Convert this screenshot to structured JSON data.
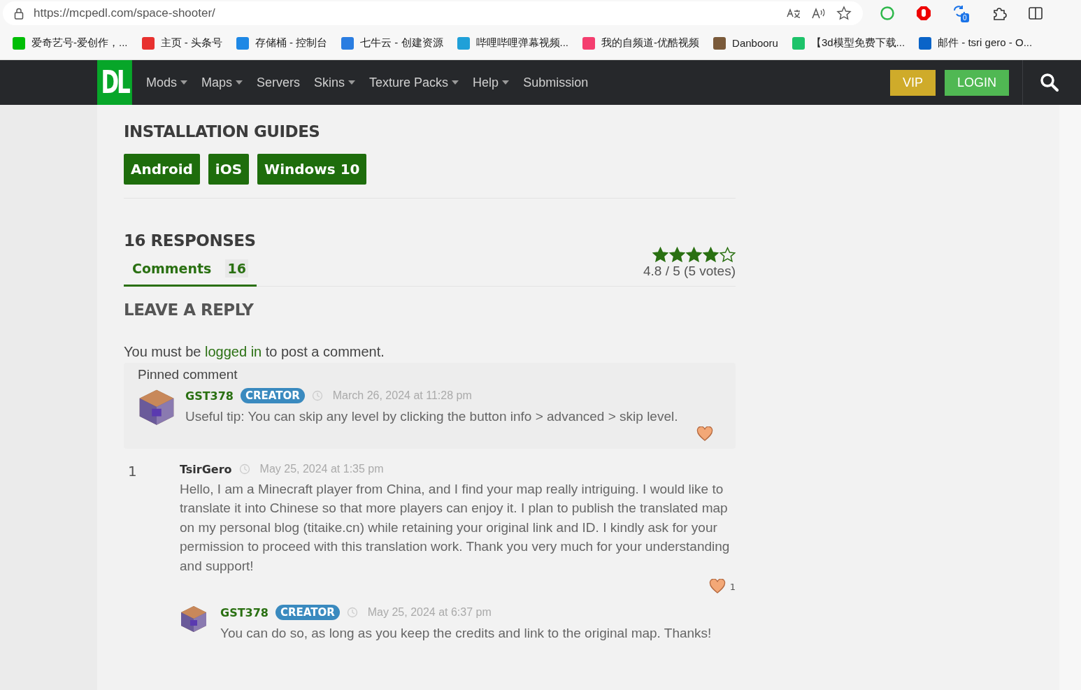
{
  "browser": {
    "url": "https://mcpedl.com/space-shooter/",
    "extension_badge": "0"
  },
  "bookmarks": [
    {
      "label": "爱奇艺号-爱创作，...",
      "color": "#00be06"
    },
    {
      "label": "主页 - 头条号",
      "color": "#e8312f"
    },
    {
      "label": "存储桶 - 控制台",
      "color": "#1e88e5"
    },
    {
      "label": "七牛云 - 创建资源",
      "color": "#2a7de1"
    },
    {
      "label": "哔哩哔哩弹幕视频...",
      "color": "#20a0d8"
    },
    {
      "label": "我的自频道-优酷视频",
      "color": "#f43e6f"
    },
    {
      "label": "Danbooru",
      "color": "#7a5a3a"
    },
    {
      "label": "【3d模型免费下载...",
      "color": "#1dc36a"
    },
    {
      "label": "邮件 - tsri gero - O...",
      "color": "#0a64c8"
    }
  ],
  "nav": {
    "logo": "DL",
    "items": [
      {
        "label": "Mods",
        "dropdown": true
      },
      {
        "label": "Maps",
        "dropdown": true
      },
      {
        "label": "Servers",
        "dropdown": false
      },
      {
        "label": "Skins",
        "dropdown": true
      },
      {
        "label": "Texture Packs",
        "dropdown": true
      },
      {
        "label": "Help",
        "dropdown": true
      },
      {
        "label": "Submission",
        "dropdown": false
      }
    ],
    "vip": "VIP",
    "login": "LOGIN"
  },
  "installation_guides": {
    "title": "INSTALLATION GUIDES",
    "buttons": [
      "Android",
      "iOS",
      "Windows 10"
    ]
  },
  "responses": {
    "title": "16 RESPONSES",
    "tabs": [
      {
        "label": "Comments",
        "count": "16",
        "selected": true
      }
    ],
    "rating": {
      "stars": 4,
      "text": "4.8 / 5 (5 votes)"
    }
  },
  "reply": {
    "title": "LEAVE A REPLY",
    "prompt_before": "You must be",
    "prompt_link": "logged in",
    "prompt_after": "to post a comment."
  },
  "pinned": {
    "label": "Pinned comment",
    "comment": {
      "author": "GST378",
      "badge": "CREATOR",
      "date": "March 26, 2024 at 11:28 pm",
      "text": "Useful tip: You can skip any level by clicking the button info > advanced > skip level."
    }
  },
  "comments": [
    {
      "number": "1",
      "author": "TsirGero",
      "date": "May 25, 2024 at 1:35 pm",
      "text": "Hello, I am a Minecraft player from China, and I find your map really intriguing. I would like to translate it into Chinese so that more players can enjoy it. I plan to publish the translated map on my personal blog (titaike.cn) while retaining your original link and ID. I kindly ask for your permission to proceed with this translation work. Thank you very much for your understanding and support!",
      "likes": "1",
      "replies": [
        {
          "author": "GST378",
          "badge": "CREATOR",
          "date": "May 25, 2024 at 6:37 pm",
          "text": "You can do so, as long as you keep the credits and link to the original map. Thanks!"
        }
      ]
    }
  ]
}
